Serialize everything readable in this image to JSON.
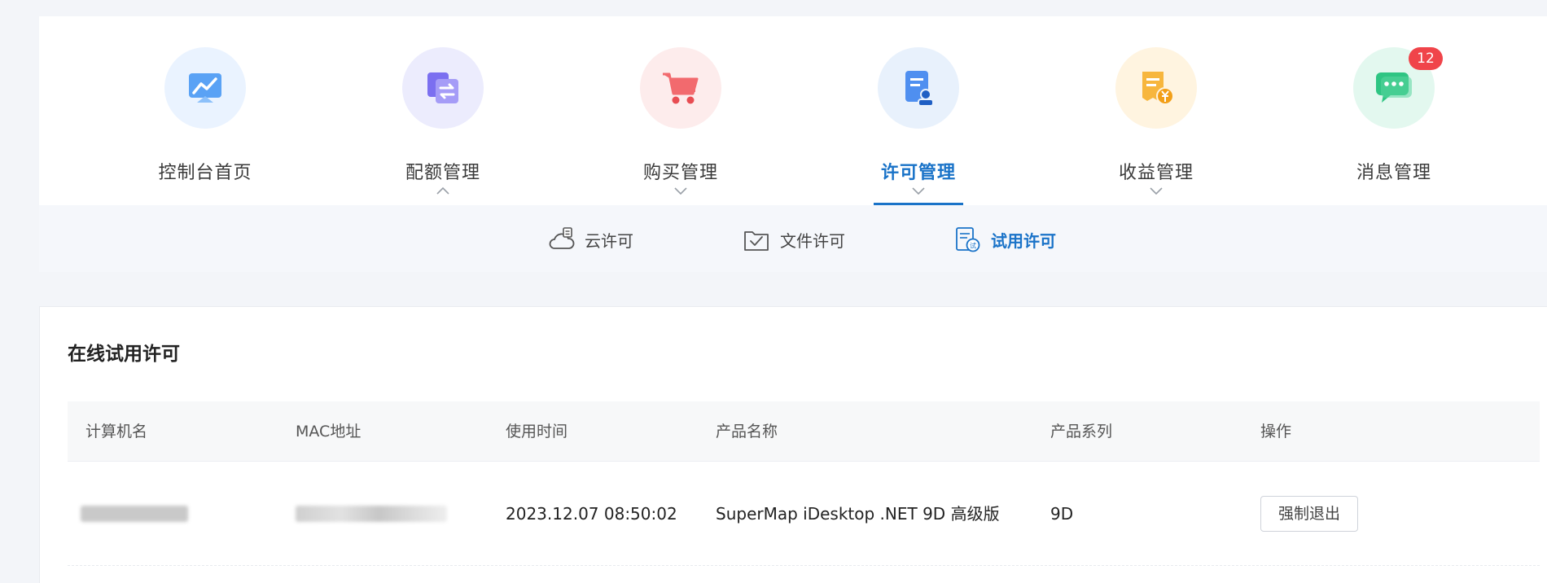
{
  "nav": {
    "items": [
      {
        "label": "控制台首页",
        "icon": "dashboard-chart-icon",
        "bg": "#eaf3ff"
      },
      {
        "label": "配额管理",
        "icon": "quota-exchange-icon",
        "bg": "#ececfd"
      },
      {
        "label": "购买管理",
        "icon": "shopping-cart-icon",
        "bg": "#fdecec"
      },
      {
        "label": "许可管理",
        "icon": "license-document-icon",
        "bg": "#e8f1fc",
        "active": true
      },
      {
        "label": "收益管理",
        "icon": "revenue-yen-icon",
        "bg": "#fff4e0"
      },
      {
        "label": "消息管理",
        "icon": "message-chat-icon",
        "bg": "#e3f8ef",
        "badge": "12"
      }
    ]
  },
  "subtabs": [
    {
      "label": "云许可",
      "icon": "cloud-server-icon"
    },
    {
      "label": "文件许可",
      "icon": "folder-check-icon"
    },
    {
      "label": "试用许可",
      "icon": "trial-clipboard-icon",
      "active": true
    }
  ],
  "section": {
    "title": "在线试用许可"
  },
  "table": {
    "headers": [
      "计算机名",
      "MAC地址",
      "使用时间",
      "产品名称",
      "产品系列",
      "操作"
    ],
    "rows": [
      {
        "computer": "",
        "mac": "",
        "time": "2023.12.07 08:50:02",
        "product": "SuperMap iDesktop .NET 9D 高级版",
        "series": "9D",
        "action": "强制退出"
      }
    ]
  },
  "colors": {
    "accent": "#1a73c8",
    "badge": "#f0444a"
  }
}
